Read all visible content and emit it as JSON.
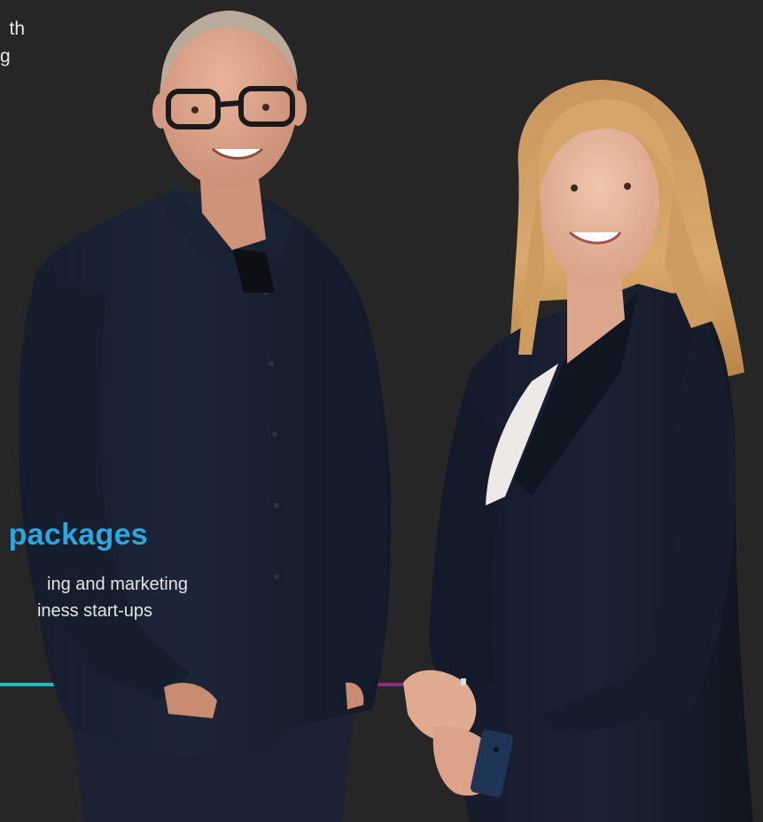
{
  "top_text": {
    "line_1": "th",
    "line_2": "g"
  },
  "packages": {
    "heading": "packages",
    "description_line_1": "ing and marketing",
    "description_line_2": "iness start-ups"
  },
  "colors": {
    "background": "#262626",
    "heading_accent": "#2aa7e0",
    "accent_line_teal": "#1fb8c4",
    "accent_line_purple": "#8a2d86"
  },
  "photo": {
    "subject": "two-people-portrait"
  }
}
